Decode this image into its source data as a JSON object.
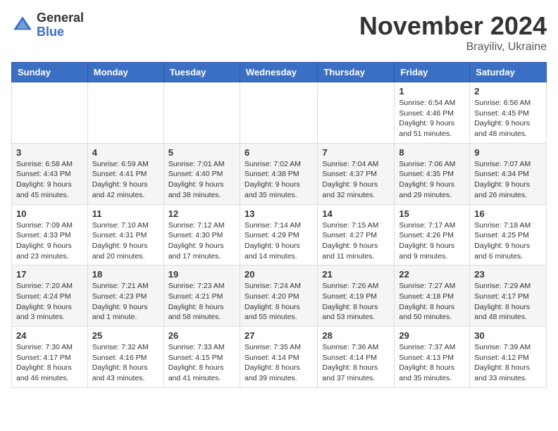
{
  "logo": {
    "general": "General",
    "blue": "Blue"
  },
  "title": "November 2024",
  "location": "Brayiliv, Ukraine",
  "weekdays": [
    "Sunday",
    "Monday",
    "Tuesday",
    "Wednesday",
    "Thursday",
    "Friday",
    "Saturday"
  ],
  "weeks": [
    [
      {
        "day": "",
        "info": ""
      },
      {
        "day": "",
        "info": ""
      },
      {
        "day": "",
        "info": ""
      },
      {
        "day": "",
        "info": ""
      },
      {
        "day": "",
        "info": ""
      },
      {
        "day": "1",
        "info": "Sunrise: 6:54 AM\nSunset: 4:46 PM\nDaylight: 9 hours and 51 minutes."
      },
      {
        "day": "2",
        "info": "Sunrise: 6:56 AM\nSunset: 4:45 PM\nDaylight: 9 hours and 48 minutes."
      }
    ],
    [
      {
        "day": "3",
        "info": "Sunrise: 6:58 AM\nSunset: 4:43 PM\nDaylight: 9 hours and 45 minutes."
      },
      {
        "day": "4",
        "info": "Sunrise: 6:59 AM\nSunset: 4:41 PM\nDaylight: 9 hours and 42 minutes."
      },
      {
        "day": "5",
        "info": "Sunrise: 7:01 AM\nSunset: 4:40 PM\nDaylight: 9 hours and 38 minutes."
      },
      {
        "day": "6",
        "info": "Sunrise: 7:02 AM\nSunset: 4:38 PM\nDaylight: 9 hours and 35 minutes."
      },
      {
        "day": "7",
        "info": "Sunrise: 7:04 AM\nSunset: 4:37 PM\nDaylight: 9 hours and 32 minutes."
      },
      {
        "day": "8",
        "info": "Sunrise: 7:06 AM\nSunset: 4:35 PM\nDaylight: 9 hours and 29 minutes."
      },
      {
        "day": "9",
        "info": "Sunrise: 7:07 AM\nSunset: 4:34 PM\nDaylight: 9 hours and 26 minutes."
      }
    ],
    [
      {
        "day": "10",
        "info": "Sunrise: 7:09 AM\nSunset: 4:33 PM\nDaylight: 9 hours and 23 minutes."
      },
      {
        "day": "11",
        "info": "Sunrise: 7:10 AM\nSunset: 4:31 PM\nDaylight: 9 hours and 20 minutes."
      },
      {
        "day": "12",
        "info": "Sunrise: 7:12 AM\nSunset: 4:30 PM\nDaylight: 9 hours and 17 minutes."
      },
      {
        "day": "13",
        "info": "Sunrise: 7:14 AM\nSunset: 4:29 PM\nDaylight: 9 hours and 14 minutes."
      },
      {
        "day": "14",
        "info": "Sunrise: 7:15 AM\nSunset: 4:27 PM\nDaylight: 9 hours and 11 minutes."
      },
      {
        "day": "15",
        "info": "Sunrise: 7:17 AM\nSunset: 4:26 PM\nDaylight: 9 hours and 9 minutes."
      },
      {
        "day": "16",
        "info": "Sunrise: 7:18 AM\nSunset: 4:25 PM\nDaylight: 9 hours and 6 minutes."
      }
    ],
    [
      {
        "day": "17",
        "info": "Sunrise: 7:20 AM\nSunset: 4:24 PM\nDaylight: 9 hours and 3 minutes."
      },
      {
        "day": "18",
        "info": "Sunrise: 7:21 AM\nSunset: 4:23 PM\nDaylight: 9 hours and 1 minute."
      },
      {
        "day": "19",
        "info": "Sunrise: 7:23 AM\nSunset: 4:21 PM\nDaylight: 8 hours and 58 minutes."
      },
      {
        "day": "20",
        "info": "Sunrise: 7:24 AM\nSunset: 4:20 PM\nDaylight: 8 hours and 55 minutes."
      },
      {
        "day": "21",
        "info": "Sunrise: 7:26 AM\nSunset: 4:19 PM\nDaylight: 8 hours and 53 minutes."
      },
      {
        "day": "22",
        "info": "Sunrise: 7:27 AM\nSunset: 4:18 PM\nDaylight: 8 hours and 50 minutes."
      },
      {
        "day": "23",
        "info": "Sunrise: 7:29 AM\nSunset: 4:17 PM\nDaylight: 8 hours and 48 minutes."
      }
    ],
    [
      {
        "day": "24",
        "info": "Sunrise: 7:30 AM\nSunset: 4:17 PM\nDaylight: 8 hours and 46 minutes."
      },
      {
        "day": "25",
        "info": "Sunrise: 7:32 AM\nSunset: 4:16 PM\nDaylight: 8 hours and 43 minutes."
      },
      {
        "day": "26",
        "info": "Sunrise: 7:33 AM\nSunset: 4:15 PM\nDaylight: 8 hours and 41 minutes."
      },
      {
        "day": "27",
        "info": "Sunrise: 7:35 AM\nSunset: 4:14 PM\nDaylight: 8 hours and 39 minutes."
      },
      {
        "day": "28",
        "info": "Sunrise: 7:36 AM\nSunset: 4:14 PM\nDaylight: 8 hours and 37 minutes."
      },
      {
        "day": "29",
        "info": "Sunrise: 7:37 AM\nSunset: 4:13 PM\nDaylight: 8 hours and 35 minutes."
      },
      {
        "day": "30",
        "info": "Sunrise: 7:39 AM\nSunset: 4:12 PM\nDaylight: 8 hours and 33 minutes."
      }
    ]
  ]
}
